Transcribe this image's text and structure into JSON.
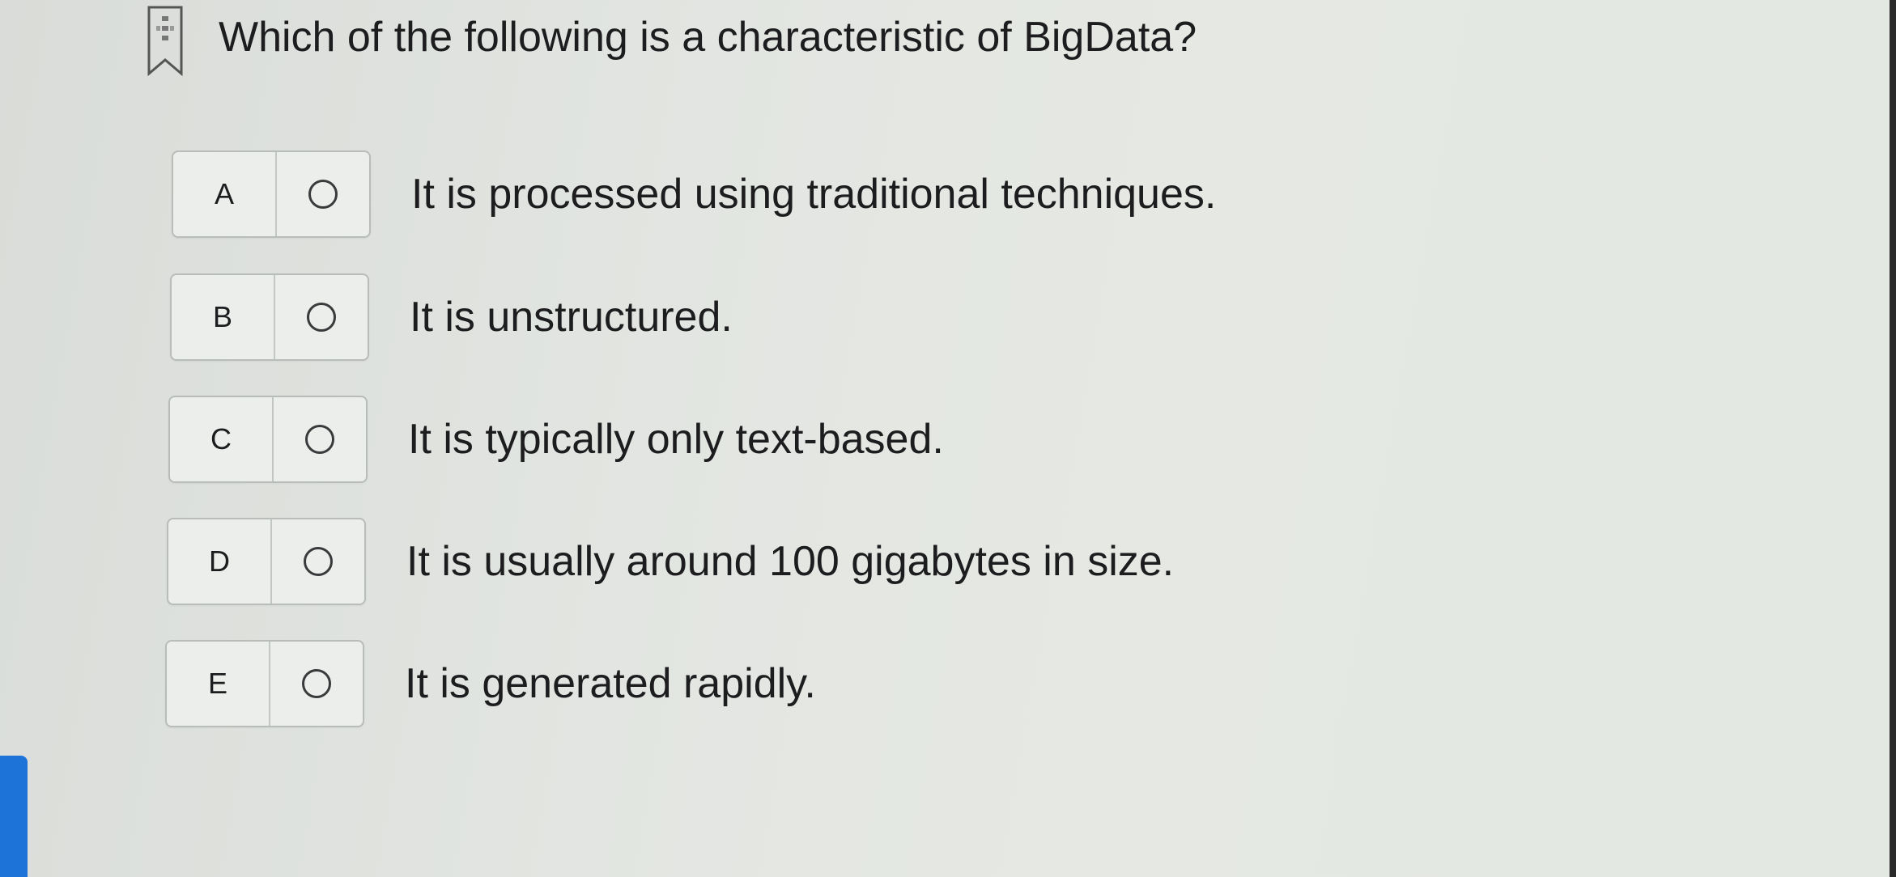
{
  "question": {
    "text": "Which of the following is a characteristic of BigData?"
  },
  "options": [
    {
      "letter": "A",
      "text": "It is processed using traditional techniques."
    },
    {
      "letter": "B",
      "text": "It is unstructured."
    },
    {
      "letter": "C",
      "text": "It is typically only text-based."
    },
    {
      "letter": "D",
      "text": "It is usually around 100 gigabytes in size."
    },
    {
      "letter": "E",
      "text": "It is generated rapidly."
    }
  ],
  "colors": {
    "accent_tab": "#1e73d8"
  },
  "icons": {
    "bookmark": "bookmark-icon",
    "radio": "radio-button-icon"
  }
}
